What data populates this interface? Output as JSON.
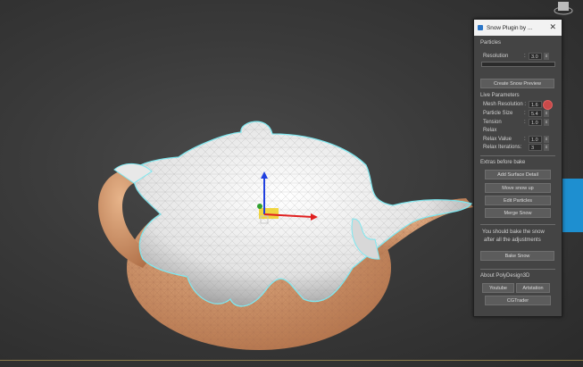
{
  "panel": {
    "title": "Snow Plugin by ...",
    "close_glyph": "✕",
    "particles": {
      "heading": "Particles",
      "resolution_label": "Resolution",
      "resolution_value": "3.0",
      "create_preview": "Create Snow Preview"
    },
    "live": {
      "heading": "Live Parameters",
      "mesh_resolution_label": "Mesh Resolution :",
      "mesh_resolution_value": "1.6",
      "particle_size_label": "Particle Size",
      "particle_size_value": "5.4",
      "tension_label": "Tension",
      "tension_value": "1.0",
      "relax_label": "Relax",
      "relax_value_label": "Relax Value",
      "relax_value_value": "1.0",
      "relax_iterations_label": "Relax Iterations:",
      "relax_iterations_value": "3"
    },
    "extras": {
      "heading": "Extras before bake",
      "add_surface_detail": "Add Surface Detail",
      "move_snow_up": "Move snow up",
      "edit_particles": "Edit Particles",
      "merge_snow": "Merge Snow"
    },
    "bake": {
      "note_line1": "You should bake the snow",
      "note_line2": "after all the adjustments",
      "bake_button": "Bake Snow"
    },
    "about": {
      "heading": "About PolyDesign3D",
      "youtube": "Youtube",
      "artstation": "Artstation",
      "cgtrader": "CGTrader"
    },
    "colon": ":",
    "spin_arrow": "⇕"
  },
  "colors": {
    "panel_bg": "#444444",
    "teapot": "#d49a70",
    "snow": "#f2f2f2",
    "selection_outline": "#7fe8f0",
    "gizmo_x": "#e02020",
    "gizmo_y": "#f0d020",
    "gizmo_z": "#2040e0"
  }
}
